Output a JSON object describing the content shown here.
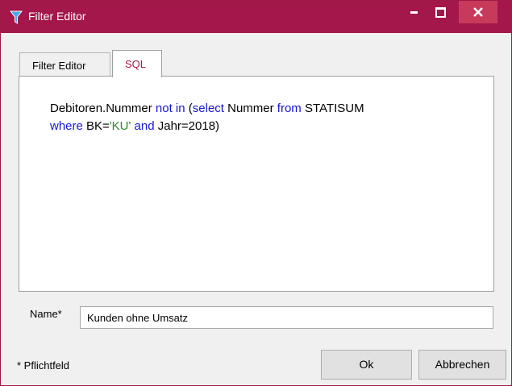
{
  "window": {
    "title": "Filter Editor",
    "icon": "filter-funnel-icon",
    "accent_color": "#a3174a"
  },
  "tabs": [
    {
      "label": "Filter Editor",
      "active": false
    },
    {
      "label": "SQL",
      "active": true
    }
  ],
  "sql": {
    "line1": [
      {
        "text": "Debitoren.Nummer ",
        "kind": "plain"
      },
      {
        "text": "not in",
        "kind": "keyword"
      },
      {
        "text": " (",
        "kind": "plain"
      },
      {
        "text": "select",
        "kind": "keyword"
      },
      {
        "text": " Nummer ",
        "kind": "plain"
      },
      {
        "text": "from",
        "kind": "keyword"
      },
      {
        "text": " STATISUM",
        "kind": "plain"
      }
    ],
    "line2": [
      {
        "text": "where",
        "kind": "keyword"
      },
      {
        "text": " BK=",
        "kind": "plain"
      },
      {
        "text": "'KU'",
        "kind": "string"
      },
      {
        "text": " ",
        "kind": "plain"
      },
      {
        "text": "and",
        "kind": "keyword"
      },
      {
        "text": " Jahr=2018)",
        "kind": "plain"
      }
    ]
  },
  "form": {
    "name_label": "Name*",
    "name_value": "Kunden ohne Umsatz"
  },
  "footer": {
    "required_note": "* Pflichtfeld",
    "ok_label": "Ok",
    "cancel_label": "Abbrechen"
  }
}
